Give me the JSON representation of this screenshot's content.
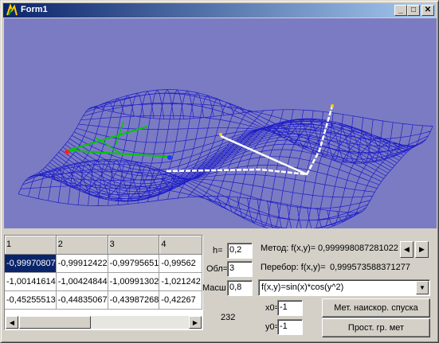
{
  "window": {
    "title": "Form1"
  },
  "grid": {
    "headers": [
      "1",
      "2",
      "3",
      "4"
    ],
    "rows": [
      [
        "-0,99970807",
        "-0,99912422",
        "-0,99795651",
        "-0,99562"
      ],
      [
        "-1,00141614",
        "-1,00424844",
        "-1,00991302",
        "-1,021242"
      ],
      [
        "-0,45255513",
        "-0,44835067",
        "-0,43987268",
        "-0,42267"
      ]
    ]
  },
  "params": {
    "h_label": "h=",
    "h_value": "0,2",
    "obl_label": "Обл=",
    "obl_value": "3",
    "masht_label": "Масш",
    "masht_value": "0,8",
    "counter": "232",
    "x0_label": "x0=",
    "x0_value": "-1",
    "y0_label": "y0=",
    "y0_value": "-1"
  },
  "results": {
    "method_label": "Метод: f(x,y)=",
    "method_value": "0,999998087281022",
    "search_label": "Перебор: f(x,y)=",
    "search_value": "0,999573588371277"
  },
  "function_combo": {
    "selected": "f(x,y)=sin(x)*cos(y^2)"
  },
  "buttons": {
    "steepest": "Мет. наискор. спуска",
    "simple_grad": "Прост. гр. мет"
  },
  "colors": {
    "viewport_bg": "#7b7bc3",
    "mesh": "#1c1cc8",
    "path": "#ffffff",
    "green_axes": "#00c800"
  }
}
